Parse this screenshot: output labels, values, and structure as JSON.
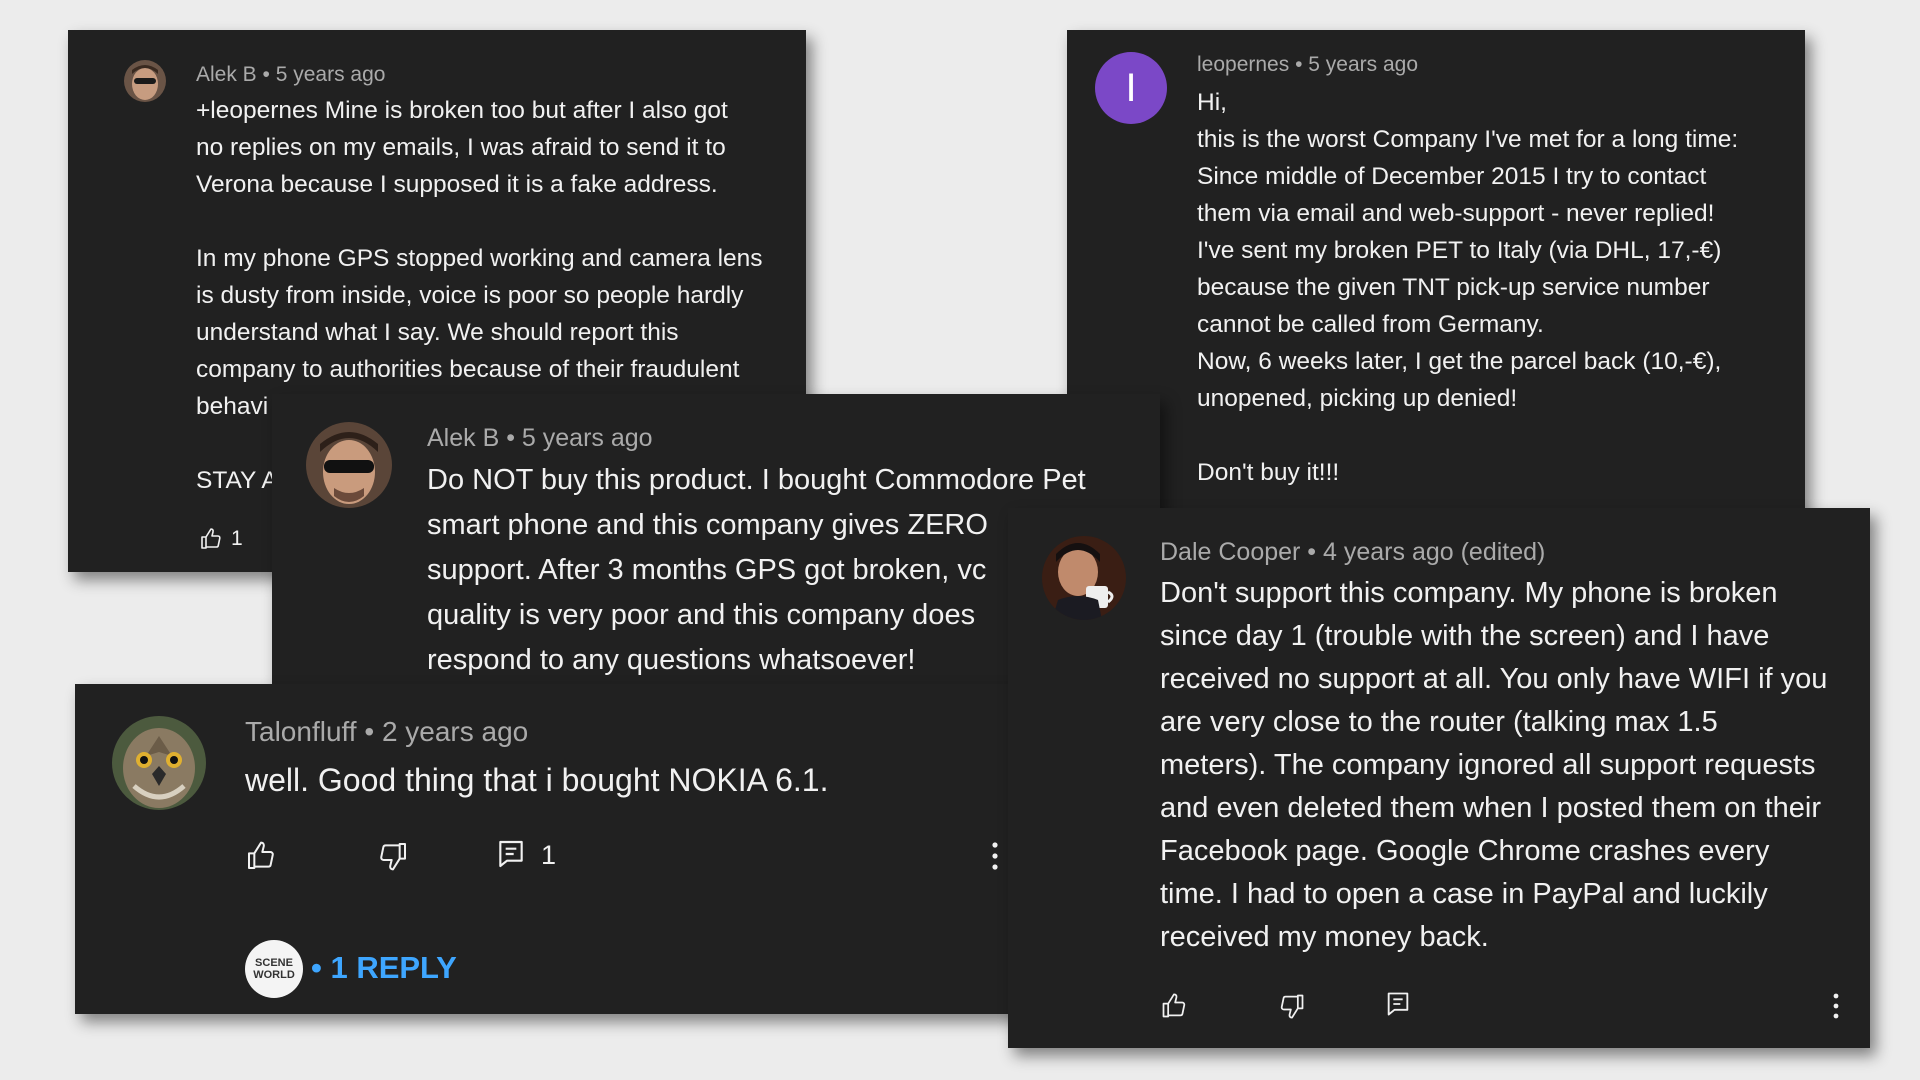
{
  "comments": {
    "alek_reply": {
      "author": "Alek B",
      "time": "5 years ago",
      "text": "+leopernes Mine is broken too but after I also got\nno replies on my emails, I was afraid to send it to\nVerona because I supposed it is a fake address.\n\nIn my phone GPS stopped working and camera lens\nis dusty from inside, voice is poor so people hardly\nunderstand what I say. We should report this\ncompany to authorities because of their fraudulent\nbehavi\n\nSTAY A",
      "likes": "1"
    },
    "leopernes": {
      "author": "leopernes",
      "time": "5 years ago",
      "avatar_letter": "I",
      "avatar_color": "#7b48c7",
      "text": "Hi,\nthis is the worst Company I've met for a long time:\nSince middle of December 2015 I try to contact\nthem via email and web-support - never replied!\nI've sent my broken PET to Italy (via DHL, 17,-€)\nbecause the given TNT pick-up service number\ncannot be called from Germany.\nNow, 6 weeks later, I get the parcel back (10,-€),\nunopened, picking up denied!\n\nDon't buy it!!!"
    },
    "alek_main": {
      "author": "Alek B",
      "time": "5 years ago",
      "text": "Do NOT buy this product. I bought Commodore Pet\nsmart phone and this company gives ZERO\nsupport. After 3 months GPS got broken, vc\nquality is very poor and this company does\nrespond to any questions whatsoever!"
    },
    "talonfluff": {
      "author": "Talonfluff",
      "time": "2 years ago",
      "text": "well. Good thing that i bought NOKIA 6.1.",
      "reply_count": "1",
      "replies_link": "• 1 REPLY",
      "reply_avatar_text": "SCENE WORLD"
    },
    "dale": {
      "author": "Dale Cooper",
      "time": "4 years ago (edited)",
      "text": "Don't support this company. My phone is broken\nsince day 1 (trouble with the screen) and I have\nreceived no support at all. You only have WIFI if you\nare very close to the router (talking max 1.5\nmeters). The company ignored all support requests\nand even deleted them when I posted them on their\nFacebook page. Google Chrome crashes every\ntime. I had to open a case in PayPal and luckily\nreceived my money back."
    }
  },
  "separator": " • ",
  "icons": [
    "thumb-up-icon",
    "thumb-down-icon",
    "reply-icon",
    "more-vert-icon"
  ],
  "colors": {
    "card_bg": "#212121",
    "page_bg": "#ececec",
    "link_blue": "#3ea6ff",
    "meta_gray": "#aaaaaa"
  }
}
